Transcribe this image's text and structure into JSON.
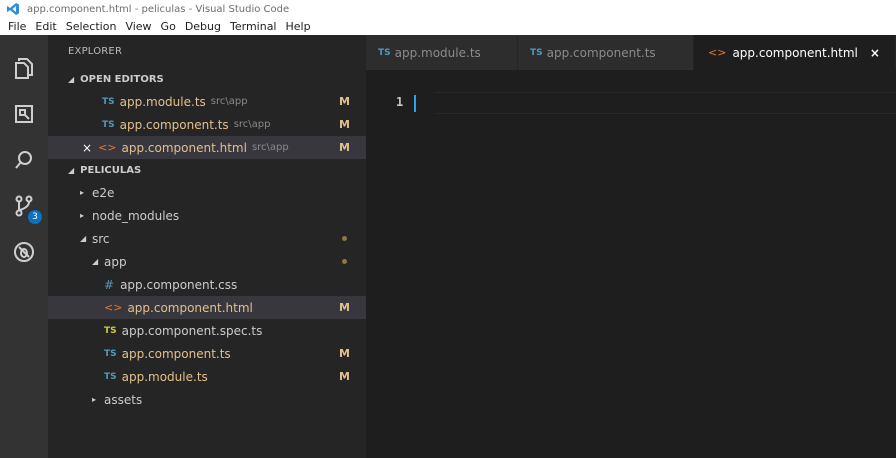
{
  "window": {
    "title": "app.component.html - peliculas - Visual Studio Code"
  },
  "menu": [
    "File",
    "Edit",
    "Selection",
    "View",
    "Go",
    "Debug",
    "Terminal",
    "Help"
  ],
  "activity_bar": {
    "items": [
      "files-icon",
      "extensions-icon",
      "search-icon",
      "source-control-icon",
      "debug-icon"
    ],
    "source_control_badge": "3"
  },
  "sidebar": {
    "title": "EXPLORER",
    "open_editors": {
      "label": "OPEN EDITORS",
      "items": [
        {
          "icon": "TS",
          "name": "app.module.ts",
          "path": "src\\app",
          "status": "M"
        },
        {
          "icon": "TS",
          "name": "app.component.ts",
          "path": "src\\app",
          "status": "M"
        },
        {
          "icon": "html",
          "name": "app.component.html",
          "path": "src\\app",
          "status": "M"
        }
      ]
    },
    "project": {
      "label": "PELICULAS",
      "tree": [
        {
          "name": "e2e"
        },
        {
          "name": "node_modules"
        },
        {
          "name": "src"
        },
        {
          "name": "app"
        },
        {
          "icon": "#",
          "name": "app.component.css"
        },
        {
          "icon": "html",
          "name": "app.component.html",
          "status": "M"
        },
        {
          "icon": "TS",
          "name": "app.component.spec.ts"
        },
        {
          "icon": "TS",
          "name": "app.component.ts",
          "status": "M"
        },
        {
          "icon": "TS",
          "name": "app.module.ts",
          "status": "M"
        },
        {
          "name": "assets"
        }
      ]
    }
  },
  "tabs": [
    {
      "icon": "TS",
      "label": "app.module.ts"
    },
    {
      "icon": "TS",
      "label": "app.component.ts"
    },
    {
      "icon": "html",
      "label": "app.component.html",
      "close": "×"
    }
  ],
  "editor": {
    "line_number": "1"
  },
  "icons": {
    "ts": "TS",
    "html": "<>",
    "css": "#",
    "close": "×"
  },
  "colors": {
    "accent": "#0e70c0",
    "modified": "#e2c08d",
    "html_icon": "#e37933",
    "ts_icon": "#519aba"
  }
}
